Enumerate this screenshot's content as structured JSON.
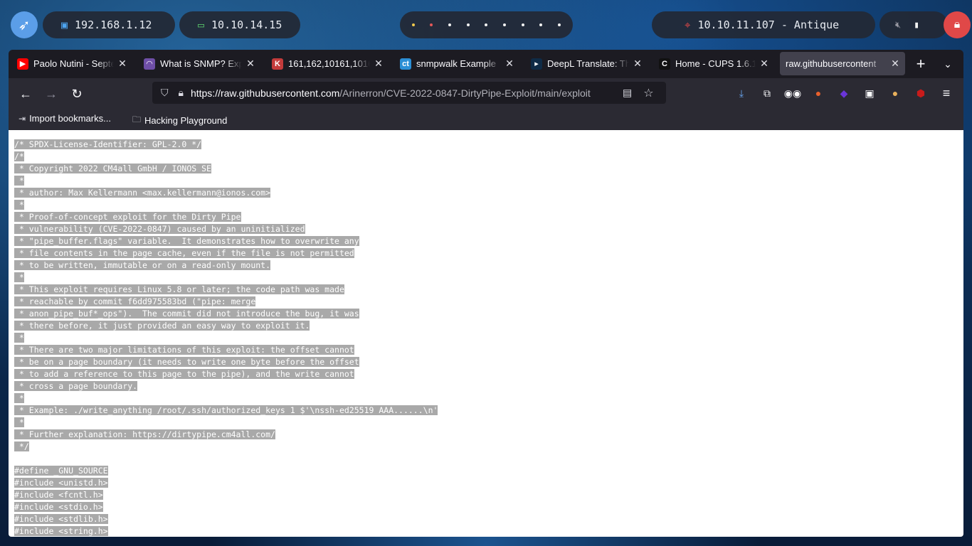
{
  "topbar": {
    "local_ip": "192.168.1.12",
    "vpn_ip": "10.10.14.15",
    "target": "10.10.11.107 - Antique",
    "workspace_dot_colors": [
      "#f2c94c",
      "#e45858",
      "#f2f2f2",
      "#f2f2f2",
      "#f2f2f2",
      "#f2f2f2",
      "#f2f2f2",
      "#f2f2f2",
      "#f2f2f2"
    ]
  },
  "tabs": [
    {
      "label": "Paolo Nutini - Septe",
      "icon": "youtube-icon",
      "color": "#ff0000",
      "glyph": "▶",
      "active": false
    },
    {
      "label": "What is SNMP? Expl",
      "icon": "wireshark-shark-icon",
      "color": "#6f4fa8",
      "glyph": "◠",
      "active": false
    },
    {
      "label": "161,162,10161,1016",
      "icon": "hacktricks-icon",
      "color": "#c43b3b",
      "glyph": "K",
      "active": false
    },
    {
      "label": "snmpwalk Example",
      "icon": "comparitech-icon",
      "color": "#2b8fd6",
      "glyph": "ct",
      "active": false
    },
    {
      "label": "DeepL Translate: Th",
      "icon": "deepl-icon",
      "color": "#0f2b46",
      "glyph": "▸",
      "active": false
    },
    {
      "label": "Home - CUPS 1.6.1",
      "icon": "cups-icon",
      "color": "#111111",
      "glyph": "C",
      "active": false
    },
    {
      "label": "raw.githubusercontent",
      "icon": "",
      "color": "#42414d",
      "glyph": "",
      "active": true
    }
  ],
  "nav": {
    "url_host": "https://raw.githubusercontent.com",
    "url_path": "/Arinerron/CVE-2022-0847-DirtyPipe-Exploit/main/exploit"
  },
  "bookmarks": {
    "import": "Import bookmarks...",
    "folder": "Hacking Playground"
  },
  "code_lines": [
    "/* SPDX-License-Identifier: GPL-2.0 */",
    "/*",
    " * Copyright 2022 CM4all GmbH / IONOS SE",
    " *",
    " * author: Max Kellermann <max.kellermann@ionos.com>",
    " *",
    " * Proof-of-concept exploit for the Dirty Pipe",
    " * vulnerability (CVE-2022-0847) caused by an uninitialized",
    " * \"pipe_buffer.flags\" variable.  It demonstrates how to overwrite any",
    " * file contents in the page cache, even if the file is not permitted",
    " * to be written, immutable or on a read-only mount.",
    " *",
    " * This exploit requires Linux 5.8 or later; the code path was made",
    " * reachable by commit f6dd975583bd (\"pipe: merge",
    " * anon_pipe_buf*_ops\").  The commit did not introduce the bug, it was",
    " * there before, it just provided an easy way to exploit it.",
    " *",
    " * There are two major limitations of this exploit: the offset cannot",
    " * be on a page boundary (it needs to write one byte before the offset",
    " * to add a reference to this page to the pipe), and the write cannot",
    " * cross a page boundary.",
    " *",
    " * Example: ./write_anything /root/.ssh/authorized_keys 1 $'\\nssh-ed25519 AAA......\\n'",
    " *",
    " * Further explanation: https://dirtypipe.cm4all.com/",
    " */",
    "",
    "#define _GNU_SOURCE",
    "#include <unistd.h>",
    "#include <fcntl.h>",
    "#include <stdio.h>",
    "#include <stdlib.h>",
    "#include <string.h>"
  ]
}
